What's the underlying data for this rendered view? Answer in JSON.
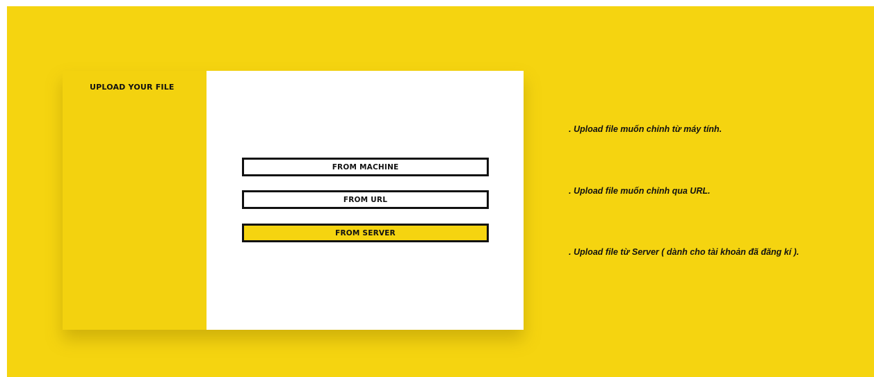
{
  "sidebar": {
    "title": "UPLOAD YOUR FILE"
  },
  "buttons": {
    "from_machine": "FROM MACHINE",
    "from_url": "FROM URL",
    "from_server": "FROM SERVER"
  },
  "descriptions": {
    "machine": ". Upload file muốn chỉnh từ máy tính.",
    "url": ". Upload file muốn chỉnh qua URL.",
    "server": ". Upload file từ Server ( dành cho tài khoản đã đăng kí )."
  },
  "colors": {
    "background": "#f5d410",
    "panel": "#ffffff",
    "text": "#111111",
    "active_button": "#f5d410"
  }
}
